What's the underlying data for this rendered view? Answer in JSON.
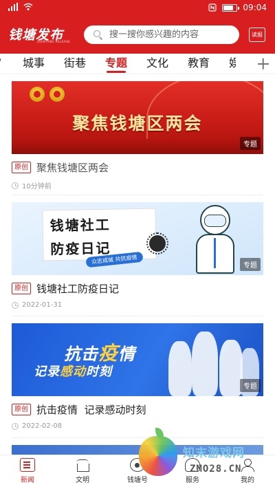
{
  "status_bar": {
    "time": "09:04"
  },
  "header": {
    "logo_text": "钱塘发布",
    "logo_subtext": "QIANTANG RELEASE",
    "search_placeholder": "搜一搜你感兴趣的内容",
    "read_paper_label": "读报"
  },
  "tabs": [
    {
      "label": "城事"
    },
    {
      "label": "街巷"
    },
    {
      "label": "专题",
      "active": true
    },
    {
      "label": "文化"
    },
    {
      "label": "教育"
    }
  ],
  "feed": [
    {
      "banner_title": "聚焦钱塘区两会",
      "tag": "专题",
      "badge": "原创",
      "title": "聚焦钱塘区两会",
      "time": "10分钟前"
    },
    {
      "banner_line1": "钱塘社工",
      "banner_line2": "防疫日记",
      "banner_slogan": "众志成城 共抗疫情",
      "tag": "专题",
      "badge": "原创",
      "title": "钱塘社工防疫日记",
      "time": "2022-01-31"
    },
    {
      "banner_line1_a": "抗击",
      "banner_line1_b": "疫",
      "banner_line1_c": "情",
      "banner_line2_a": "记录",
      "banner_line2_b": "感动",
      "banner_line2_c": "时刻",
      "tag": "专题",
      "badge": "原创",
      "title": "抗击疫情  记录感动时刻",
      "time": "2022-02-08"
    }
  ],
  "bottom_nav": [
    {
      "label": "新闻",
      "icon": "newspaper-icon",
      "active": true
    },
    {
      "label": "文明",
      "icon": "civilization-icon"
    },
    {
      "label": "钱塘号",
      "icon": "qiantang-hao-icon"
    },
    {
      "label": "服务",
      "icon": "service-icon"
    },
    {
      "label": "我的",
      "icon": "profile-icon"
    }
  ],
  "watermark": {
    "text": "知末游戏网",
    "url": "ZMO28.CN"
  },
  "colors": {
    "brand_red": "#d81e1e",
    "banner_blue": "#2670d8",
    "gold": "#fde7a0"
  }
}
